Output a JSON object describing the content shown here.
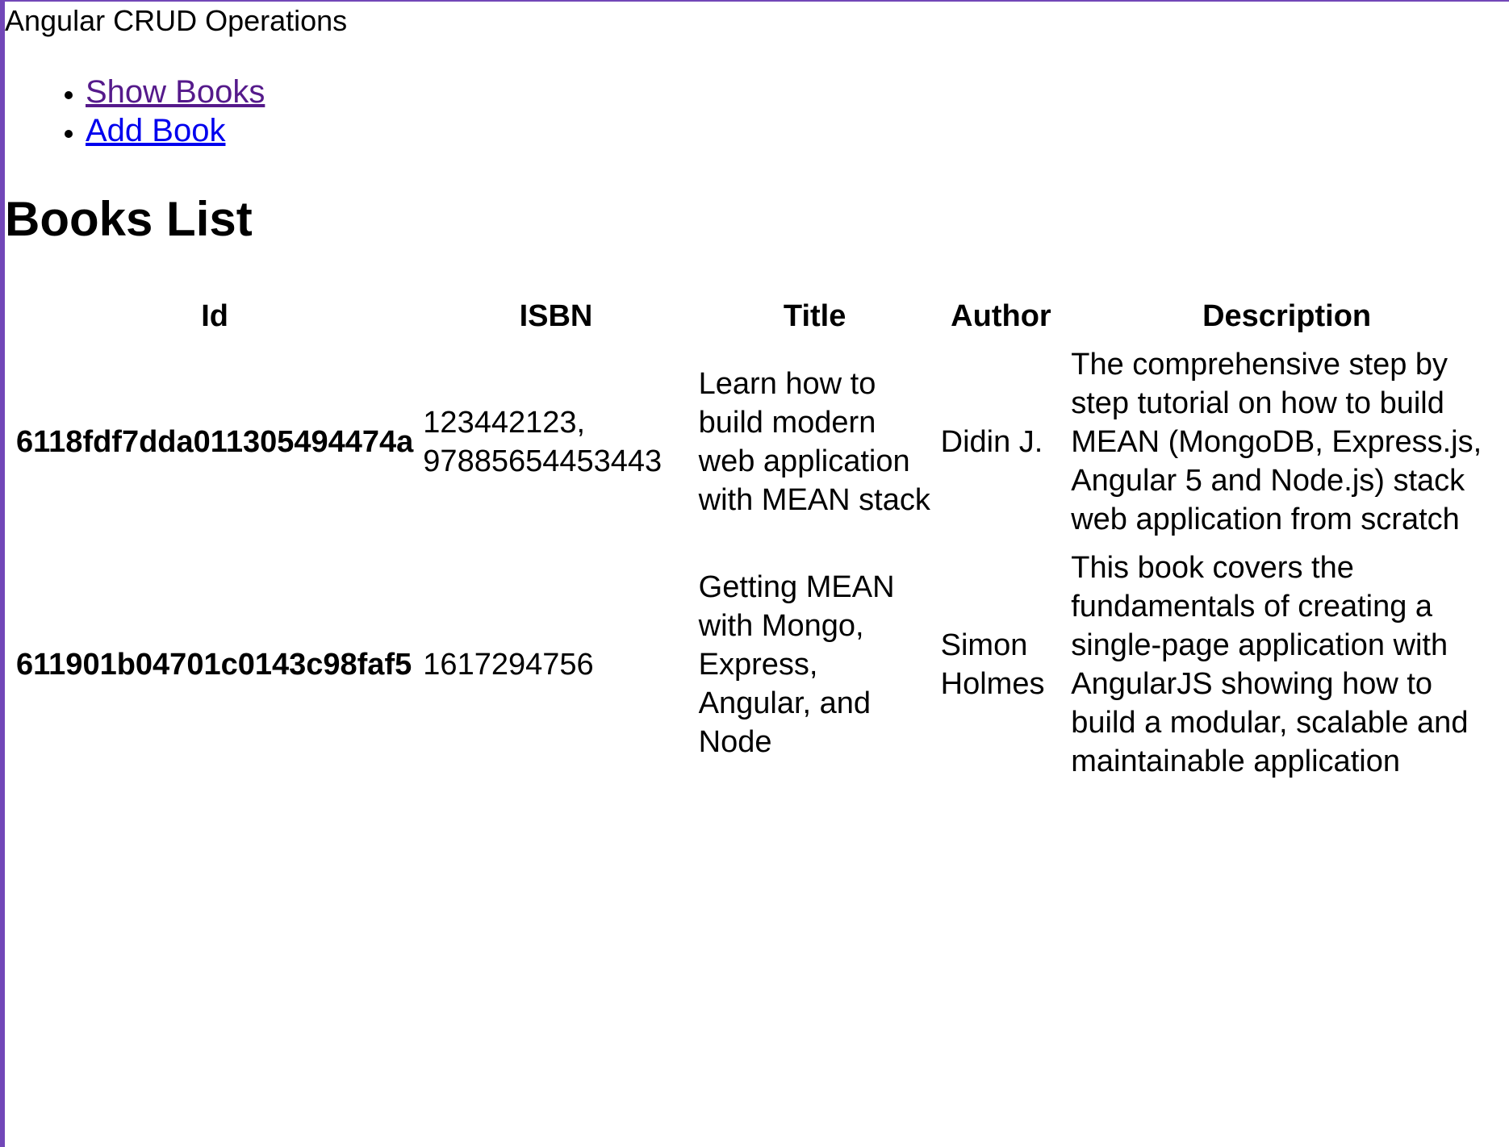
{
  "app": {
    "title": "Angular CRUD Operations"
  },
  "nav": {
    "items": [
      {
        "label": "Show Books",
        "state": "visited"
      },
      {
        "label": "Add Book",
        "state": "unvisited"
      }
    ]
  },
  "page": {
    "heading": "Books List"
  },
  "table": {
    "headers": {
      "id": "Id",
      "isbn": "ISBN",
      "title": "Title",
      "author": "Author",
      "description": "Description"
    },
    "rows": [
      {
        "id": "6118fdf7dda011305494474a",
        "isbn": "123442123, 97885654453443",
        "title": "Learn how to build modern web application with MEAN stack",
        "author": "Didin J.",
        "description": "The comprehensive step by step tutorial on how to build MEAN (MongoDB, Express.js, Angular 5 and Node.js) stack web application from scratch"
      },
      {
        "id": "611901b04701c0143c98faf5",
        "isbn": "1617294756",
        "title": "Getting MEAN with Mongo, Express, Angular, and Node",
        "author": "Simon Holmes",
        "description": "This book covers the fundamentals of creating a single-page application with AngularJS showing how to build a modular, scalable and maintainable application"
      }
    ]
  },
  "colors": {
    "frame": "#7247b8",
    "visited_link": "#551a8b",
    "link": "#0000ee"
  }
}
